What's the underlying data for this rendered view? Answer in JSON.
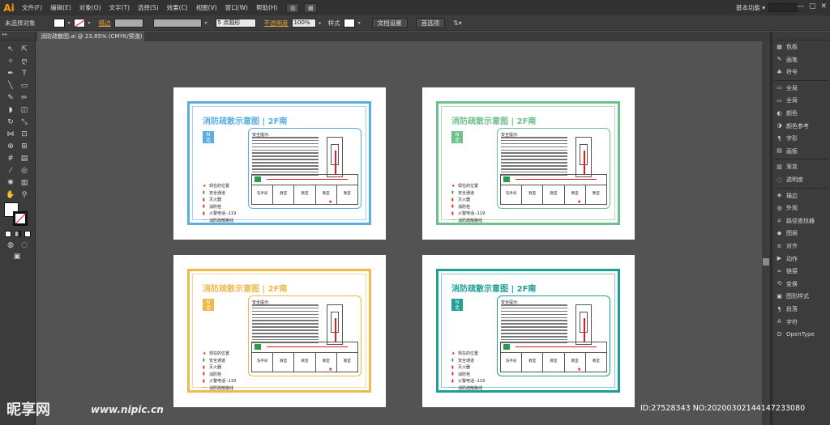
{
  "app": {
    "logo": "Ai"
  },
  "menu": [
    "文件(F)",
    "编辑(E)",
    "对象(O)",
    "文字(T)",
    "选择(S)",
    "效果(C)",
    "视图(V)",
    "窗口(W)",
    "帮助(H)"
  ],
  "workspace": {
    "label": "基本功能",
    "arrow": "▾"
  },
  "window_buttons": [
    "—",
    "▢",
    "✕"
  ],
  "control": {
    "selection": "未选择对象",
    "stroke_label": "描边",
    "points": "5 点圆形",
    "opacity_label": "不透明度",
    "opacity_value": "100%",
    "style_label": "样式",
    "doc_setup": "文档设置",
    "prefs": "首选项"
  },
  "document_tab": {
    "title": "消防疏散图.ai @ 23.85% (CMYK/预览)",
    "close": "×"
  },
  "sign": {
    "title": "消防疏散示意图 | 2F南",
    "north": "N",
    "north_sub": "北",
    "notice_title": "安全提示:",
    "rooms": [
      "洗手间",
      "教室",
      "教室",
      "教室",
      "教室"
    ],
    "star": "★",
    "legend": [
      "现在的位置",
      "安全通道",
      "灭火器",
      "消防栓",
      "火警电话--119",
      "消防疏散路线"
    ]
  },
  "artboards": [
    {
      "color": "#5aaee0",
      "legend_color": "#e21b1b"
    },
    {
      "color": "#6ec08d",
      "legend_color": "#e21b1b"
    },
    {
      "color": "#f1b84e",
      "legend_color": "#e21b1b"
    },
    {
      "color": "#1f9e95",
      "legend_color": "#e21b1b"
    }
  ],
  "right_panel": [
    {
      "icon": "▦",
      "label": "色板"
    },
    {
      "icon": "✎",
      "label": "画笔"
    },
    {
      "icon": "♣",
      "label": "符号"
    },
    {
      "icon": "▭",
      "label": "全局"
    },
    {
      "icon": "▭",
      "label": "全局"
    },
    {
      "icon": "◐",
      "label": "颜色"
    },
    {
      "icon": "◑",
      "label": "颜色参考"
    },
    {
      "icon": "¶",
      "label": "字形"
    },
    {
      "icon": "▤",
      "label": "画板"
    },
    {
      "icon": "▥",
      "label": "渐变"
    },
    {
      "icon": "◌",
      "label": "透明度"
    },
    {
      "icon": "◈",
      "label": "描边"
    },
    {
      "icon": "◍",
      "label": "外观"
    },
    {
      "icon": "⌂",
      "label": "路径查找器"
    },
    {
      "icon": "◆",
      "label": "图层"
    },
    {
      "icon": "≡",
      "label": "对齐"
    },
    {
      "icon": "▶",
      "label": "动作"
    },
    {
      "icon": "∞",
      "label": "链接"
    },
    {
      "icon": "⟲",
      "label": "变换"
    },
    {
      "icon": "▣",
      "label": "图形样式"
    },
    {
      "icon": "¶",
      "label": "段落"
    },
    {
      "icon": "A",
      "label": "字符"
    },
    {
      "icon": "O",
      "label": "OpenType"
    }
  ],
  "watermark": {
    "logo": "昵享网",
    "url": "www.nipic.cn",
    "id": "ID:27528343 NO:20200302144147233080"
  }
}
